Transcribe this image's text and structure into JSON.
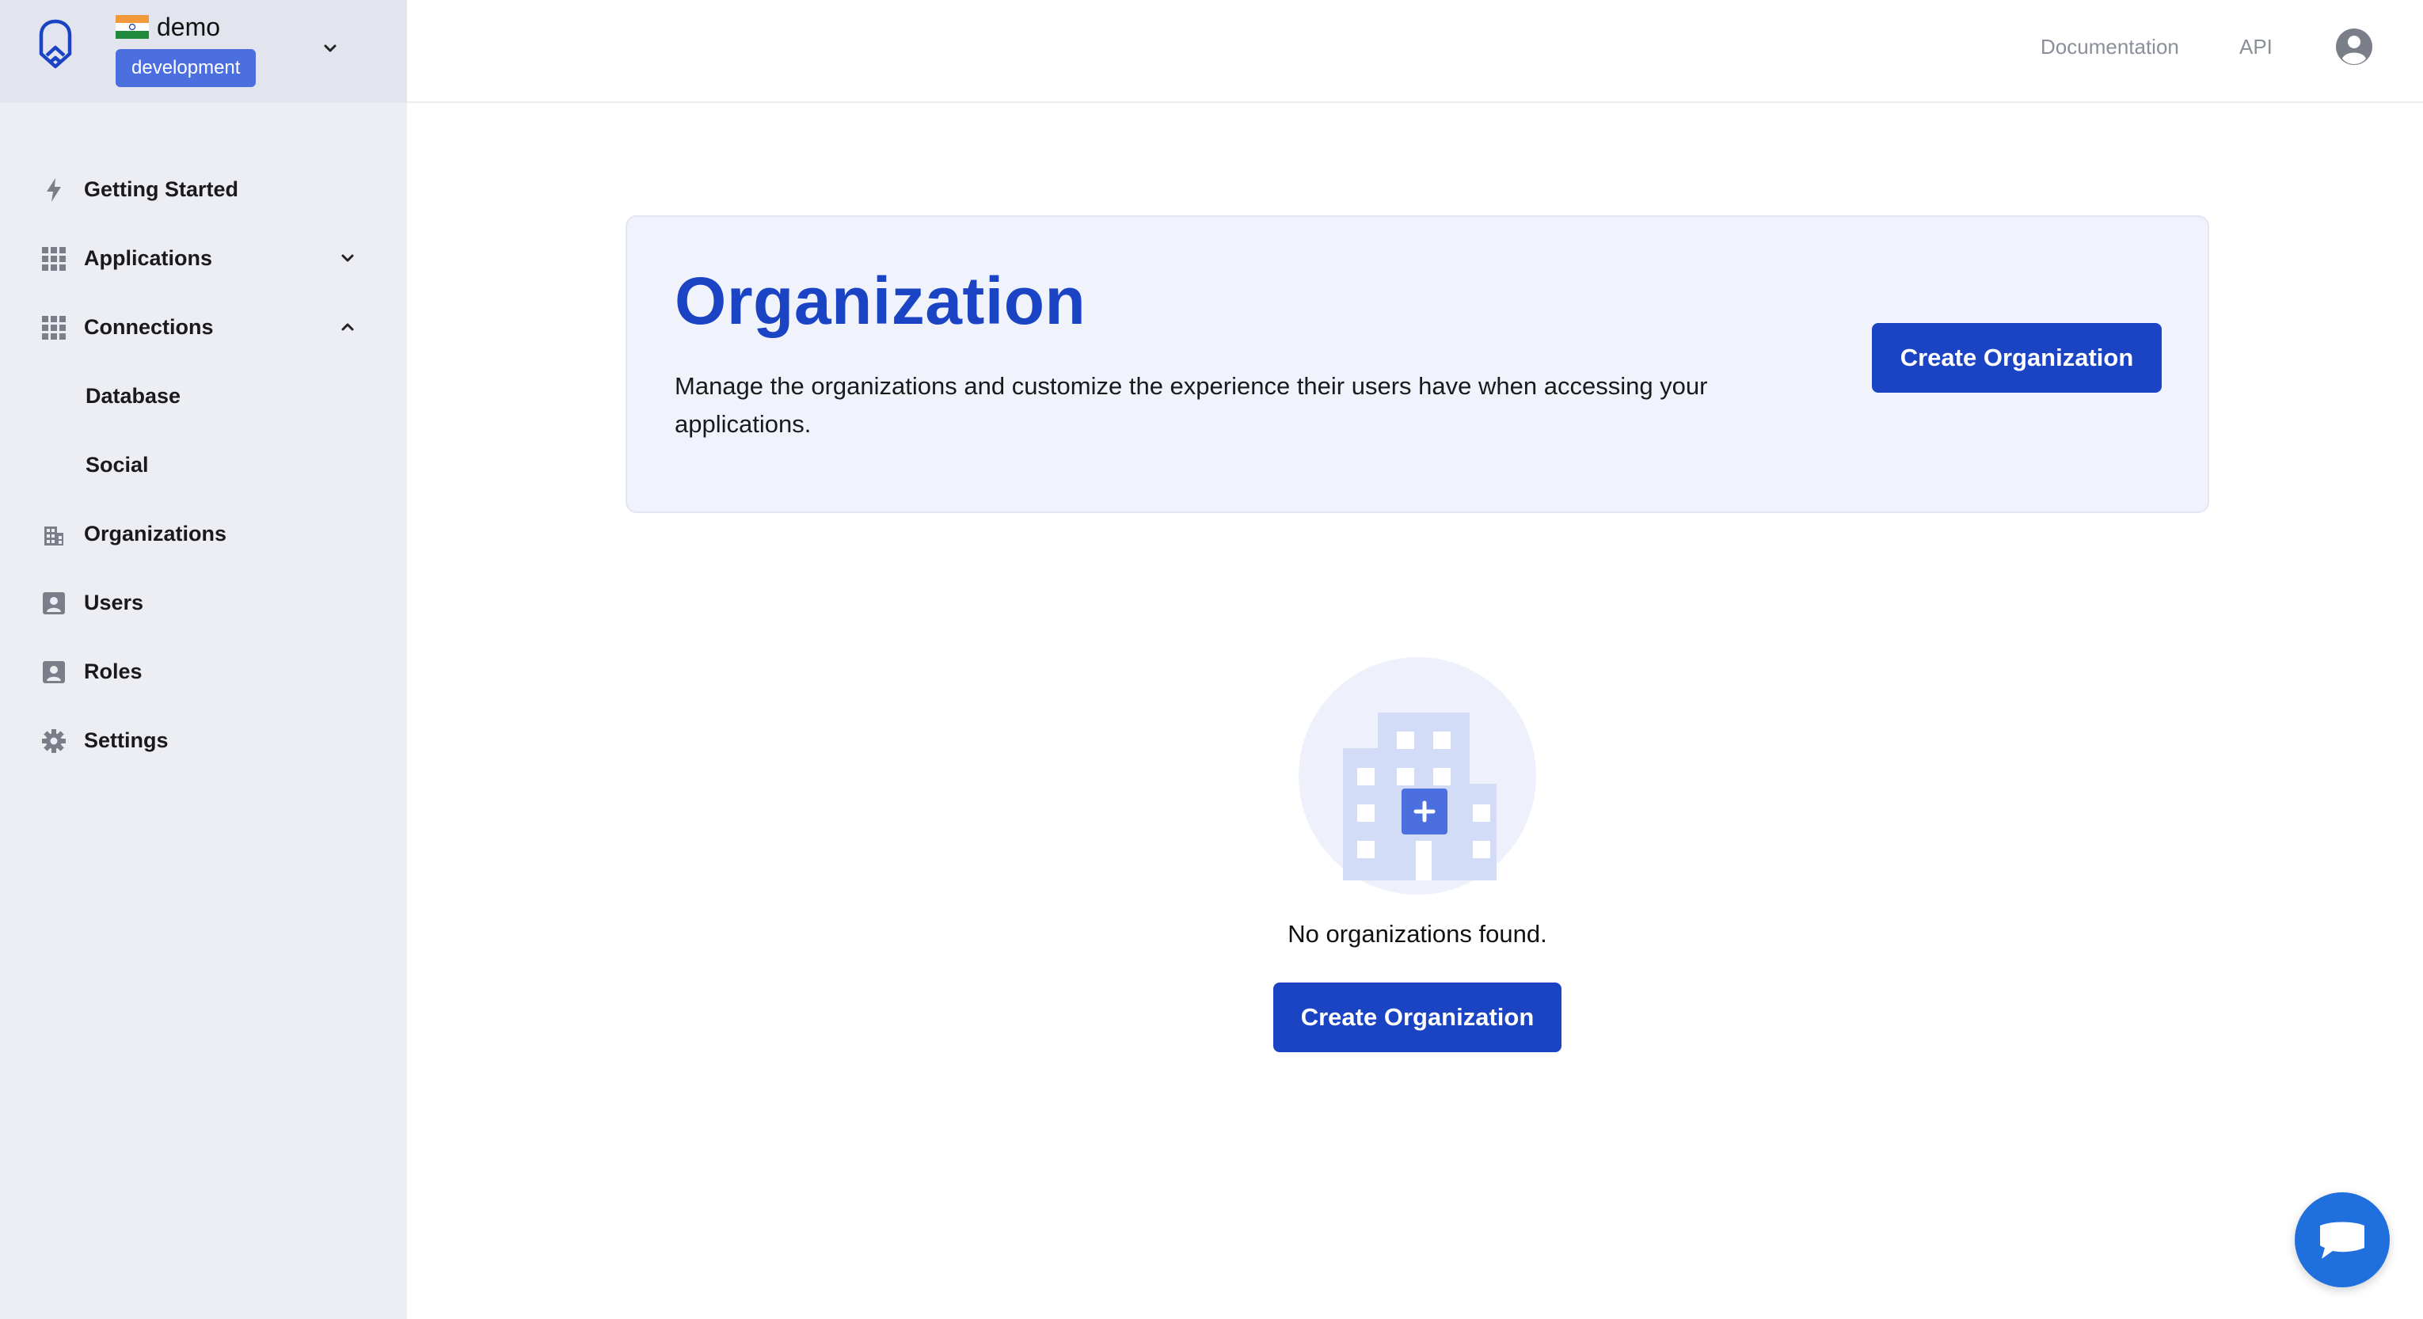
{
  "tenant": {
    "name": "demo",
    "environment": "development",
    "flag_icon": "india-flag-icon"
  },
  "sidebar": {
    "items": [
      {
        "label": "Getting Started",
        "icon": "lightning-icon"
      },
      {
        "label": "Applications",
        "icon": "grid-icon",
        "state": "collapsed"
      },
      {
        "label": "Connections",
        "icon": "grid-icon",
        "state": "expanded"
      },
      {
        "label": "Database",
        "sub": true
      },
      {
        "label": "Social",
        "sub": true
      },
      {
        "label": "Organizations",
        "icon": "building-icon"
      },
      {
        "label": "Users",
        "icon": "user-badge-icon"
      },
      {
        "label": "Roles",
        "icon": "user-badge-icon"
      },
      {
        "label": "Settings",
        "icon": "gear-icon"
      }
    ]
  },
  "topbar": {
    "documentation": "Documentation",
    "api": "API",
    "avatar_icon": "account-circle-icon"
  },
  "hero": {
    "title": "Organization",
    "description": "Manage the organizations and customize the experience their users have when accessing your applications.",
    "button": "Create Organization"
  },
  "empty_state": {
    "message": "No organizations found.",
    "button": "Create Organization",
    "illustration": "building-plus-icon"
  },
  "chat": {
    "icon": "chat-bubble-icon"
  },
  "colors": {
    "primary": "#1a44c4",
    "badge": "#4c6fe0",
    "sidebar_bg": "#edeef3",
    "hero_bg": "#f0f3fc",
    "chat": "#1f6fdc"
  }
}
